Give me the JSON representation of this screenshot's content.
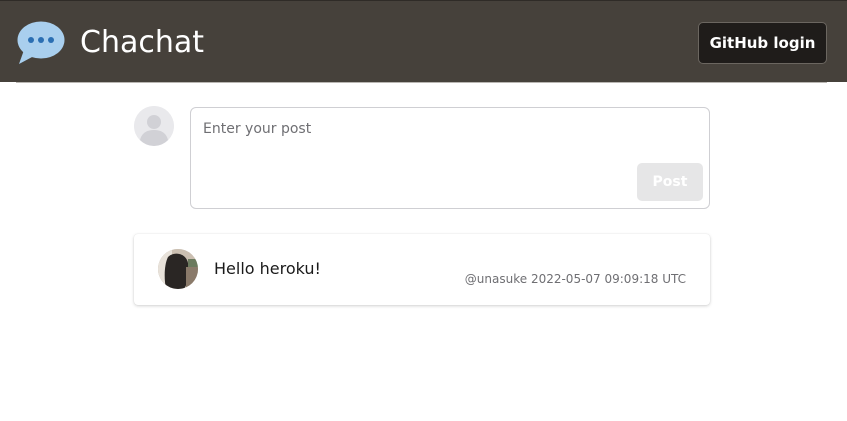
{
  "header": {
    "brand": "Chachat",
    "login_label": "GitHub login",
    "logo_icon": "chat-bubble-icon"
  },
  "composer": {
    "placeholder": "Enter your post",
    "value": "",
    "post_label": "Post",
    "avatar_icon": "default-user-icon"
  },
  "posts": [
    {
      "text": "Hello heroku!",
      "meta": "@unasuke 2022-05-07 09:09:18 UTC"
    }
  ],
  "colors": {
    "header_bg": "#46413b",
    "login_button_bg": "#1f1c1a",
    "logo_bubble": "#a9cfee",
    "post_button_bg": "#e6e6e7"
  }
}
